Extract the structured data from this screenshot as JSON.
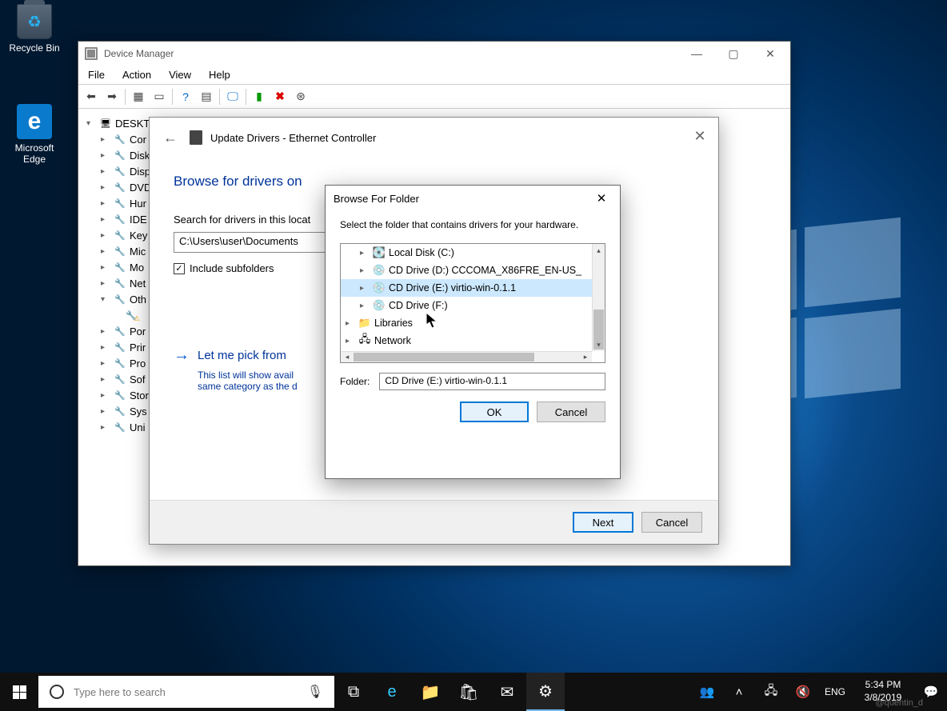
{
  "desktop": {
    "icons": {
      "recycle": "Recycle Bin",
      "edge": "Microsoft Edge"
    }
  },
  "device_manager": {
    "title": "Device Manager",
    "menu": [
      "File",
      "Action",
      "View",
      "Help"
    ],
    "root": "DESKTO",
    "nodes": [
      "Cor",
      "Disk",
      "Disp",
      "DVD",
      "Hur",
      "IDE",
      "Key",
      "Mic",
      "Mo",
      "Net",
      "Oth",
      "Por",
      "Prir",
      "Pro",
      "Sof",
      "Stor",
      "Sys",
      "Uni"
    ]
  },
  "wizard": {
    "title": "Update Drivers - Ethernet Controller",
    "heading": "Browse for drivers on",
    "search_label": "Search for drivers in this locat",
    "path_value": "C:\\Users\\user\\Documents",
    "include_sub": "Include subfolders",
    "link_title": "Let me pick from",
    "link_sub1": "This list will show avail",
    "link_sub2": "same category as the d",
    "btn_next": "Next",
    "btn_cancel": "Cancel"
  },
  "browse": {
    "title": "Browse For Folder",
    "message": "Select the folder that contains drivers for your hardware.",
    "items": [
      {
        "label": "Local Disk (C:)",
        "indent": 1
      },
      {
        "label": "CD Drive (D:) CCCOMA_X86FRE_EN-US_",
        "indent": 1
      },
      {
        "label": "CD Drive (E:) virtio-win-0.1.1",
        "indent": 1,
        "selected": true
      },
      {
        "label": "CD Drive (F:)",
        "indent": 1
      },
      {
        "label": "Libraries",
        "indent": 0
      },
      {
        "label": "Network",
        "indent": 0
      }
    ],
    "folder_label": "Folder:",
    "folder_value": "CD Drive (E:) virtio-win-0.1.1",
    "btn_ok": "OK",
    "btn_cancel": "Cancel"
  },
  "taskbar": {
    "search_placeholder": "Type here to search",
    "lang": "ENG",
    "time": "5:34 PM",
    "date": "3/8/2019",
    "watermark": "@quentin_d"
  }
}
